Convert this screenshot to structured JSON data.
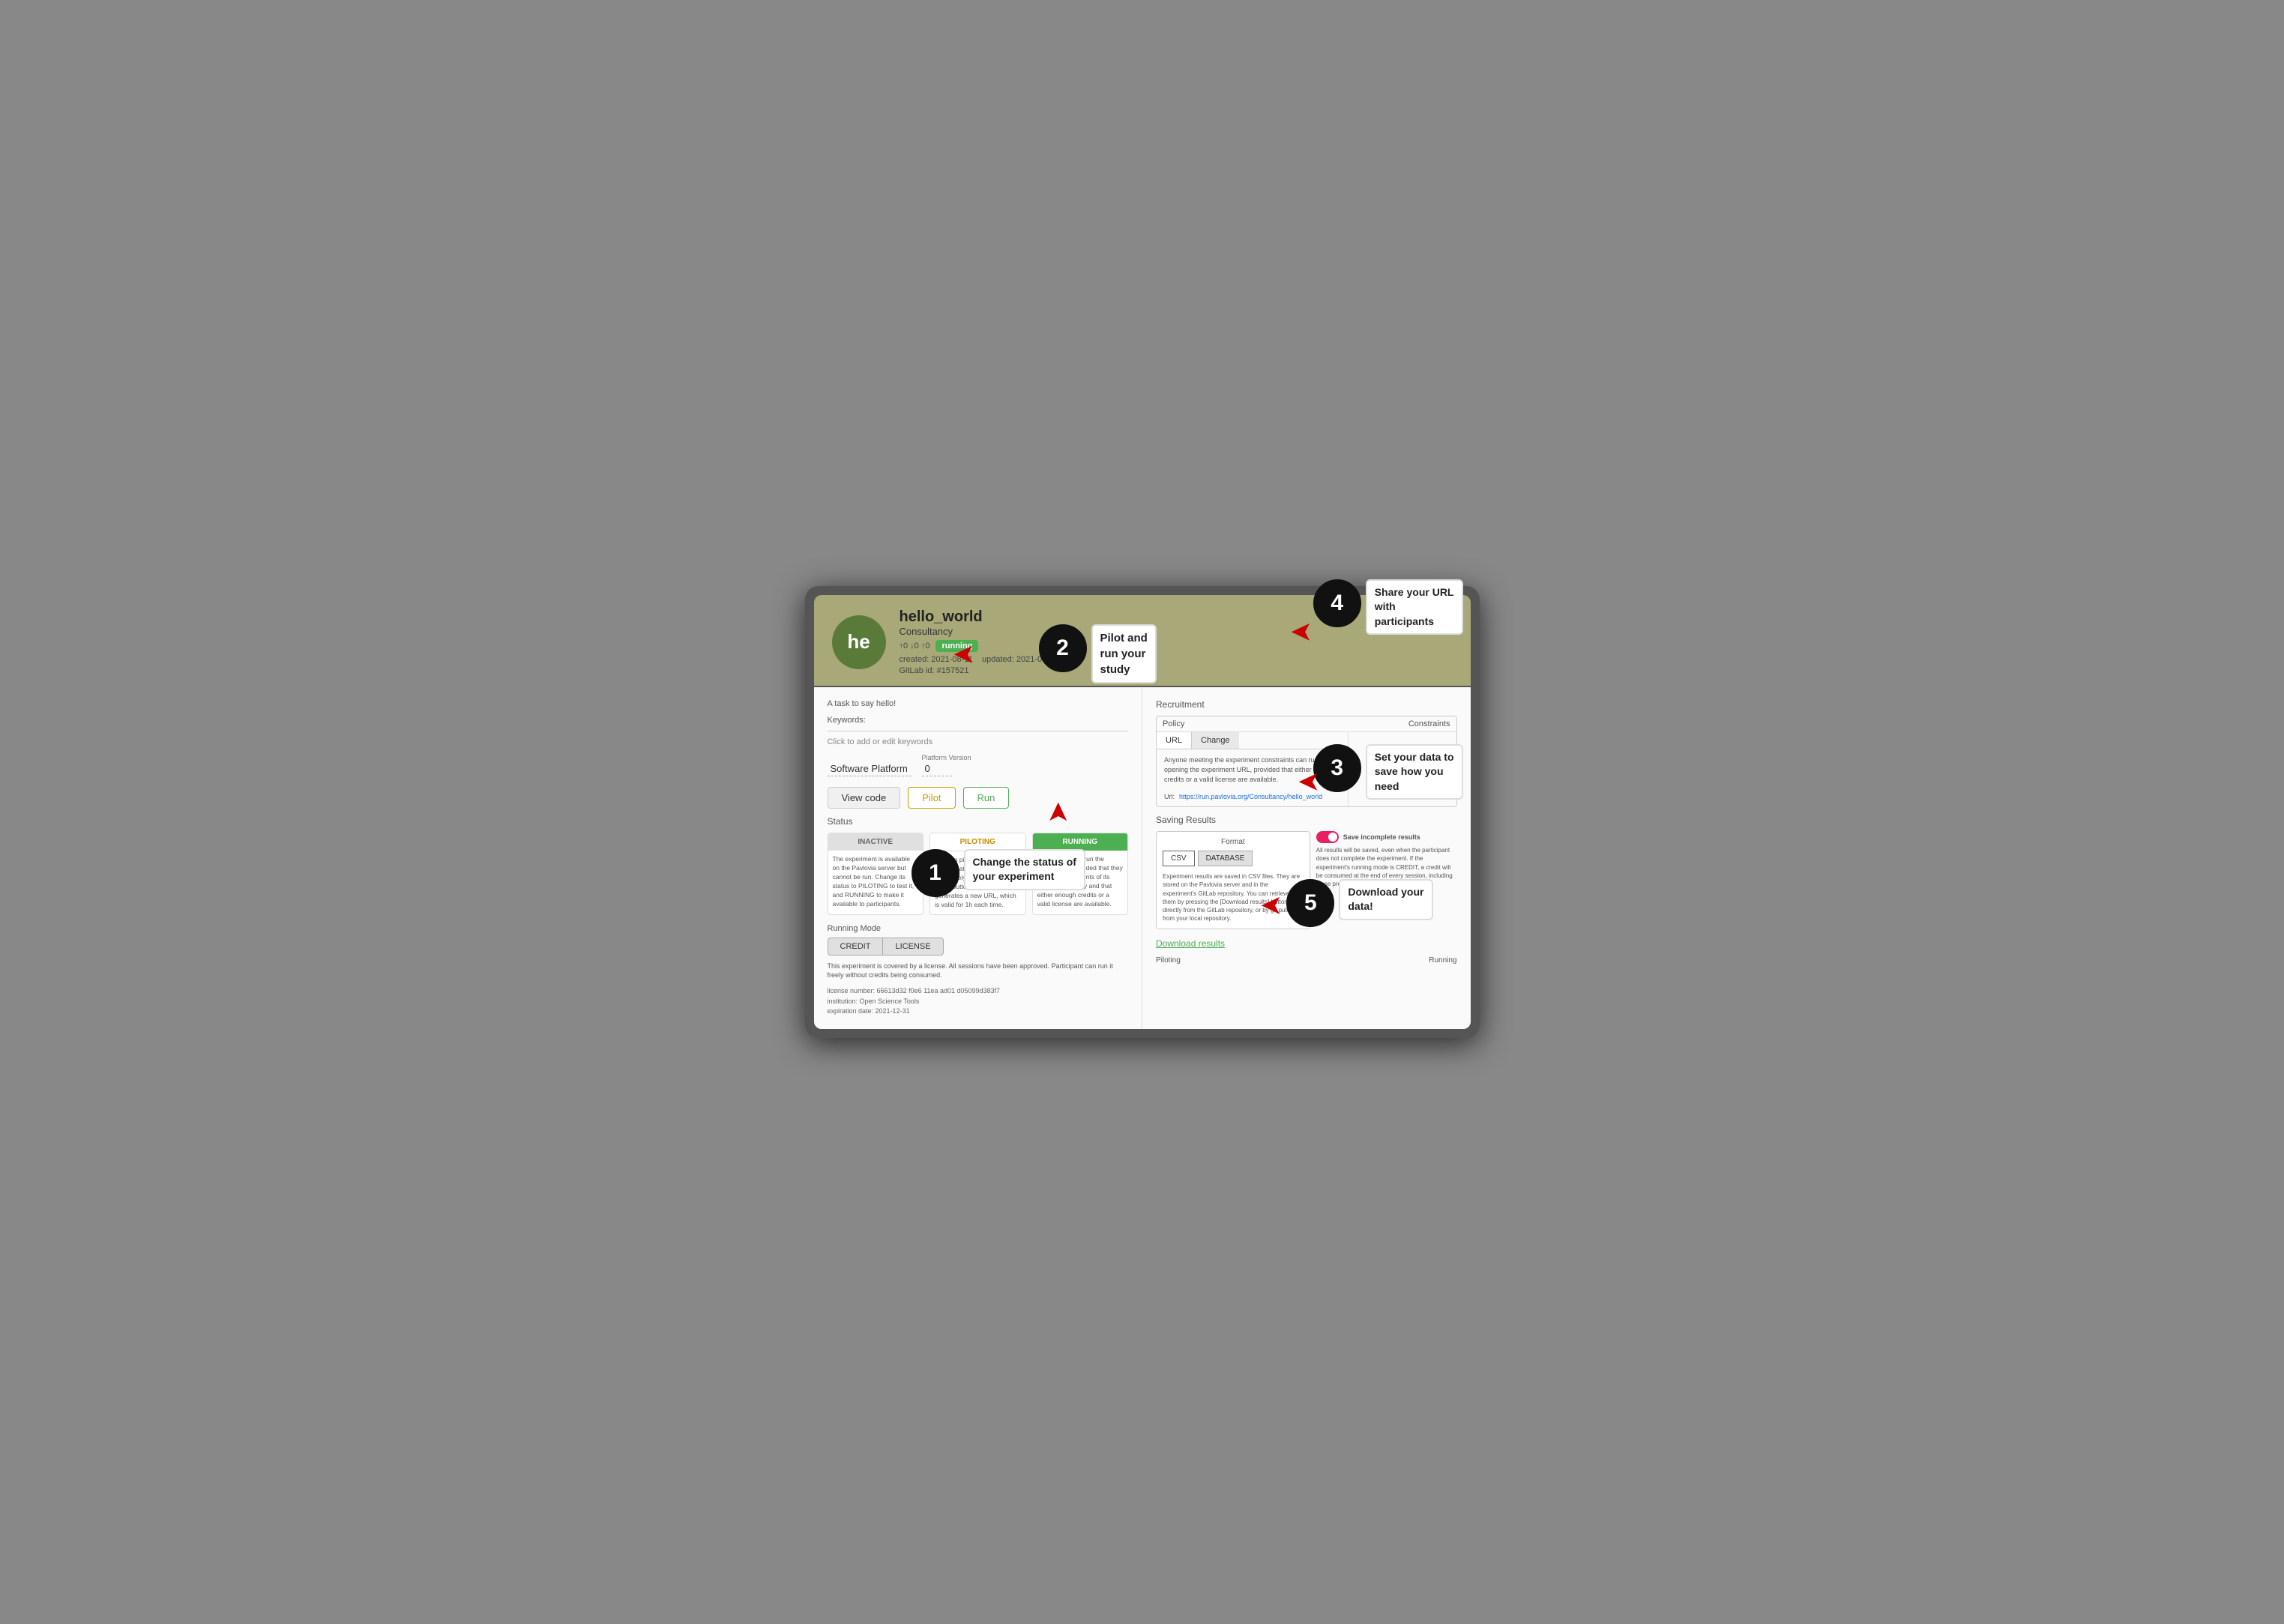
{
  "screen": {
    "header": {
      "avatar_text": "he",
      "project_name": "hello_world",
      "org": "Consultancy",
      "stats": "↑0 ↓0 ↑0",
      "badge": "running",
      "created": "created: 2021-08-11",
      "updated": "updated: 2021-08-11",
      "gitlab_id": "GitLab id: #157521"
    },
    "left": {
      "task_desc": "A task to say hello!",
      "keywords_label": "Keywords:",
      "keywords_hint": "Click to add or edit keywords",
      "platform_label": "Software Platform",
      "platform_version_label": "Platform Version",
      "platform_version_value": "0",
      "btn_view_code": "View code",
      "btn_pilot": "Pilot",
      "btn_run": "Run",
      "status_title": "Status",
      "status_cards": [
        {
          "header": "INACTIVE",
          "type": "inactive",
          "body": "The experiment is available on the Pavlovia server but cannot be run. Change its status to PILOTING to test it, and RUNNING to make it available to participants."
        },
        {
          "header": "PILOTING",
          "type": "piloting",
          "body": "You can pilot the experiment to test that it is working adequately. Pressing the [Pilot] button (above) generates a new URL, which is valid for 1h each time."
        },
        {
          "header": "RUNNING",
          "type": "running",
          "body": "Participants can run the experiment, provided that they meet the constraints of its recruitment policy and that either enough credits or a valid license are available."
        }
      ],
      "running_mode_label": "Running Mode",
      "btn_credit": "CREDIT",
      "btn_license": "LICENSE",
      "license_text": "This experiment is covered by a license. All sessions have been approved. Participant can run it freely without credits being consumed.",
      "license_number": "license number: 66613d32 f0e6 11ea ad01 d05099d383f7",
      "institution": "institution: Open Science Tools",
      "expiration_date": "expiration date: 2021-12-31"
    },
    "right": {
      "recruitment_title": "Recruitment",
      "policy_label": "Policy",
      "constraints_label": "Constraints",
      "tab_url": "URL",
      "btn_change": "Change",
      "policy_body": "Anyone meeting the experiment constraints can run it by opening the experiment URL, provided that either enough credits or a valid license are available.",
      "url_label": "Url:",
      "url_link": "https://run.pavlovia.org/Consultancy/hello_world",
      "saving_results_title": "Saving Results",
      "format_label": "Format",
      "btn_csv": "CSV",
      "btn_database": "DATABASE",
      "format_desc": "Experiment results are saved in CSV files. They are stored on the Pavlovia server and in the experiment's GitLab repository.\n\nYou can retrieve them by pressing the [Download results] button, or directly from the GitLab repository, or by git pulling from your local repository.",
      "save_incomplete_label": "Save incomplete results",
      "save_desc": "All results will be saved, even when the participant does not complete the experiment.\n\nIf the experiment's running mode is CREDIT, a credit will be consumed at the end of every session, including those prematurely interrupted.",
      "download_results_label": "Download results",
      "sessions_piloting": "Piloting",
      "sessions_running": "Running"
    },
    "annotations": [
      {
        "number": "1",
        "text": "Change the status of\nyour experiment"
      },
      {
        "number": "2",
        "text": "Pilot and\nrun your\nstudy"
      },
      {
        "number": "3",
        "text": "Set your data to\nsave how you\nneed"
      },
      {
        "number": "4",
        "text": "Share your URL\nwith\nparticipants"
      },
      {
        "number": "5",
        "text": "Download your\ndata!"
      }
    ]
  }
}
